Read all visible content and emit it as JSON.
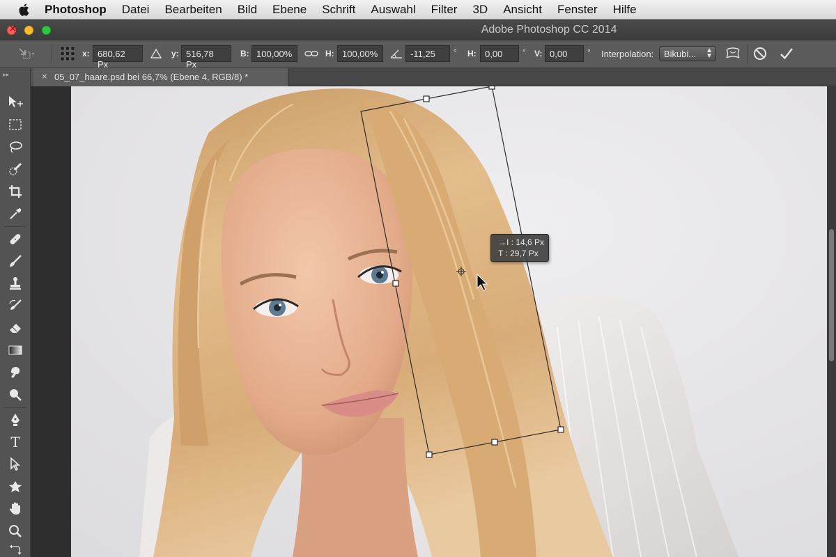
{
  "menubar": {
    "apple_icon": "apple-logo-icon",
    "app_name": "Photoshop",
    "items": [
      "Datei",
      "Bearbeiten",
      "Bild",
      "Ebene",
      "Schrift",
      "Auswahl",
      "Filter",
      "3D",
      "Ansicht",
      "Fenster",
      "Hilfe"
    ]
  },
  "window": {
    "title": "Adobe Photoshop CC 2014"
  },
  "options_bar": {
    "x_label": "x:",
    "x_value": "680,62 Px",
    "y_label": "y:",
    "y_value": "516,78 Px",
    "w_label": "B:",
    "w_value": "100,00%",
    "h_label": "H:",
    "h_value": "100,00%",
    "angle_value": "-11,25",
    "angle_unit": "°",
    "hskew_label": "H:",
    "hskew_value": "0,00",
    "hskew_unit": "°",
    "vskew_label": "V:",
    "vskew_value": "0,00",
    "vskew_unit": "°",
    "interpolation_label": "Interpolation:",
    "interpolation_value": "Bikubi..."
  },
  "document": {
    "tab_close": "×",
    "tab_title": "05_07_haare.psd bei 66,7% (Ebene 4, RGB/8) *"
  },
  "tooltip": {
    "dx": "→I : 14,6 Px",
    "dy": "T : 29,7 Px"
  },
  "tools": [
    "move-tool",
    "marquee-tool",
    "lasso-tool",
    "quick-selection-tool",
    "crop-tool",
    "eyedropper-tool",
    "healing-brush-tool",
    "brush-tool",
    "clone-stamp-tool",
    "history-brush-tool",
    "eraser-tool",
    "gradient-tool",
    "blur-tool",
    "dodge-tool",
    "pen-tool",
    "type-tool",
    "path-selection-tool",
    "shape-tool",
    "hand-tool",
    "zoom-tool"
  ],
  "type_tool_glyph": "T",
  "colors": {
    "menubar_bg": "#e6e6e6",
    "ui_dark": "#535353",
    "canvas_bg": "#e8e7e9",
    "hair": "#d8ad7a",
    "skin": "#e7b394"
  }
}
